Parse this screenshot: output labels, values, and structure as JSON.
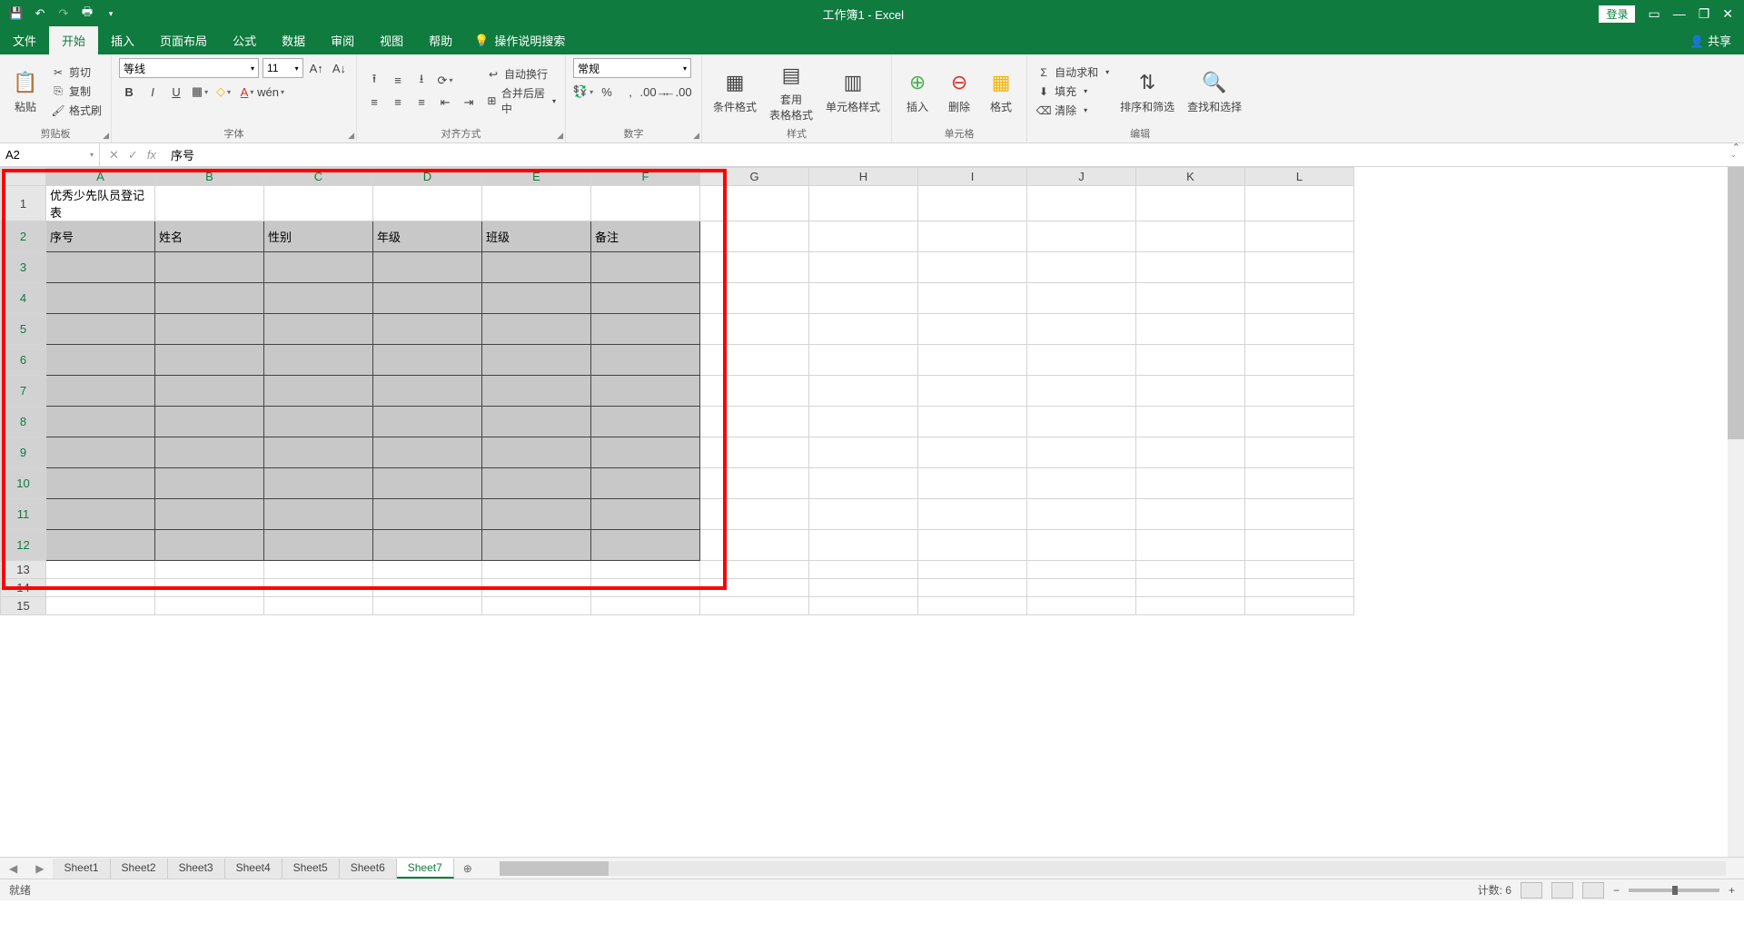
{
  "titlebar": {
    "title": "工作簿1 - Excel",
    "login": "登录"
  },
  "tabs": {
    "file": "文件",
    "home": "开始",
    "insert": "插入",
    "layout": "页面布局",
    "formulas": "公式",
    "data": "数据",
    "review": "审阅",
    "view": "视图",
    "help": "帮助",
    "tellme": "操作说明搜索",
    "share": "共享"
  },
  "ribbon": {
    "clipboard": {
      "label": "剪贴板",
      "paste": "粘贴",
      "cut": "剪切",
      "copy": "复制",
      "painter": "格式刷"
    },
    "font": {
      "label": "字体",
      "name": "等线",
      "size": "11"
    },
    "align": {
      "label": "对齐方式",
      "wrap": "自动换行",
      "merge": "合并后居中"
    },
    "number": {
      "label": "数字",
      "format": "常规"
    },
    "styles": {
      "label": "样式",
      "cond": "条件格式",
      "table": "套用\n表格格式",
      "cell": "单元格样式"
    },
    "cells": {
      "label": "单元格",
      "insert": "插入",
      "delete": "删除",
      "format": "格式"
    },
    "editing": {
      "label": "编辑",
      "sum": "自动求和",
      "fill": "填充",
      "clear": "清除",
      "sort": "排序和筛选",
      "find": "查找和选择"
    }
  },
  "namebox": "A2",
  "formula": "序号",
  "columns": [
    "A",
    "B",
    "C",
    "D",
    "E",
    "F",
    "G",
    "H",
    "I",
    "J",
    "K",
    "L"
  ],
  "rows": [
    1,
    2,
    3,
    4,
    5,
    6,
    7,
    8,
    9,
    10,
    11,
    12,
    13,
    14,
    15
  ],
  "cells": {
    "title": "优秀少先队员登记表",
    "headers": [
      "序号",
      "姓名",
      "性别",
      "年级",
      "班级",
      "备注"
    ]
  },
  "sheets": [
    "Sheet1",
    "Sheet2",
    "Sheet3",
    "Sheet4",
    "Sheet5",
    "Sheet6",
    "Sheet7"
  ],
  "active_sheet": "Sheet7",
  "status": {
    "ready": "就绪",
    "count_label": "计数:",
    "count": "6"
  }
}
